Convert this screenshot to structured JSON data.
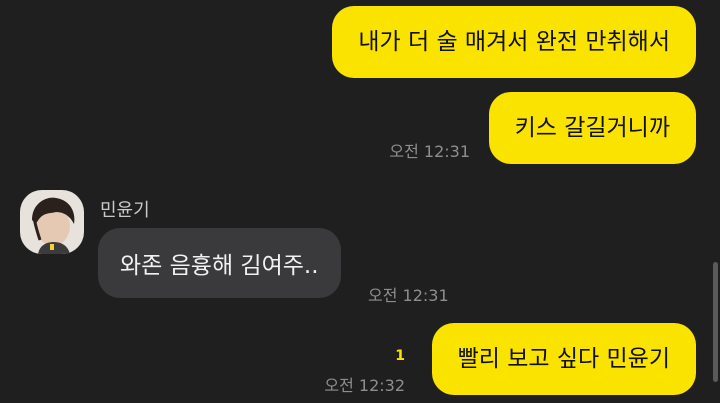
{
  "messages": {
    "m1": {
      "text": "내가 더 술 매겨서 완전 만취해서"
    },
    "m2": {
      "text": "키스 갈길거니까",
      "time": "오전 12:31"
    },
    "m3": {
      "sender": "민윤기",
      "text": "와존 음흉해 김여주..",
      "time": "오전 12:31"
    },
    "m4": {
      "text": "빨리 보고 싶다 민윤기",
      "time": "오전 12:32",
      "unread": "1"
    }
  },
  "colors": {
    "background": "#1f1f1f",
    "outgoing_bubble": "#fbe300",
    "incoming_bubble": "#3a3a3c",
    "timestamp": "#8e8e8e",
    "unread": "#fbe300"
  }
}
